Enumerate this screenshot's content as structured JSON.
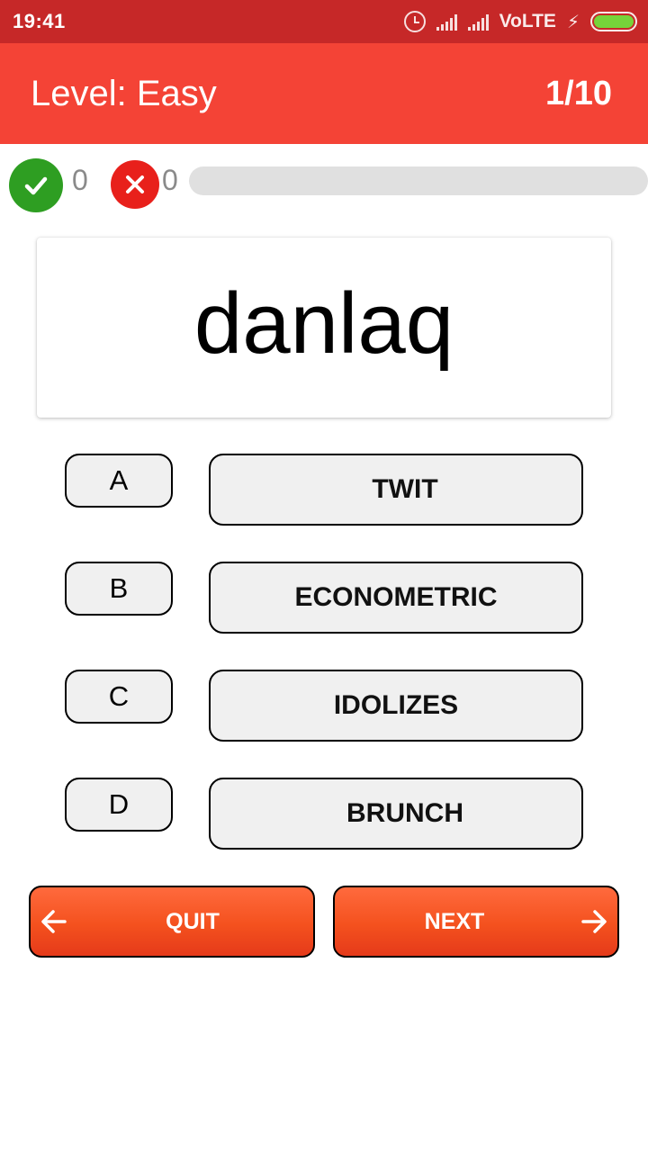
{
  "status_bar": {
    "time": "19:41",
    "network_label": "VoLTE",
    "battery_color": "#76d33a"
  },
  "app_bar": {
    "level_title": "Level: Easy",
    "progress_count": "1/10",
    "color": "#f44336"
  },
  "score": {
    "correct": "0",
    "wrong": "0",
    "progress_fraction": 0
  },
  "question": {
    "word": "danlaq"
  },
  "options": [
    {
      "letter": "A",
      "answer": "TWIT"
    },
    {
      "letter": "B",
      "answer": "ECONOMETRIC"
    },
    {
      "letter": "C",
      "answer": "IDOLIZES"
    },
    {
      "letter": "D",
      "answer": "BRUNCH"
    }
  ],
  "nav": {
    "quit_label": "QUIT",
    "next_label": "NEXT",
    "quit_icon": "arrow-left-icon",
    "next_icon": "arrow-right-icon"
  }
}
